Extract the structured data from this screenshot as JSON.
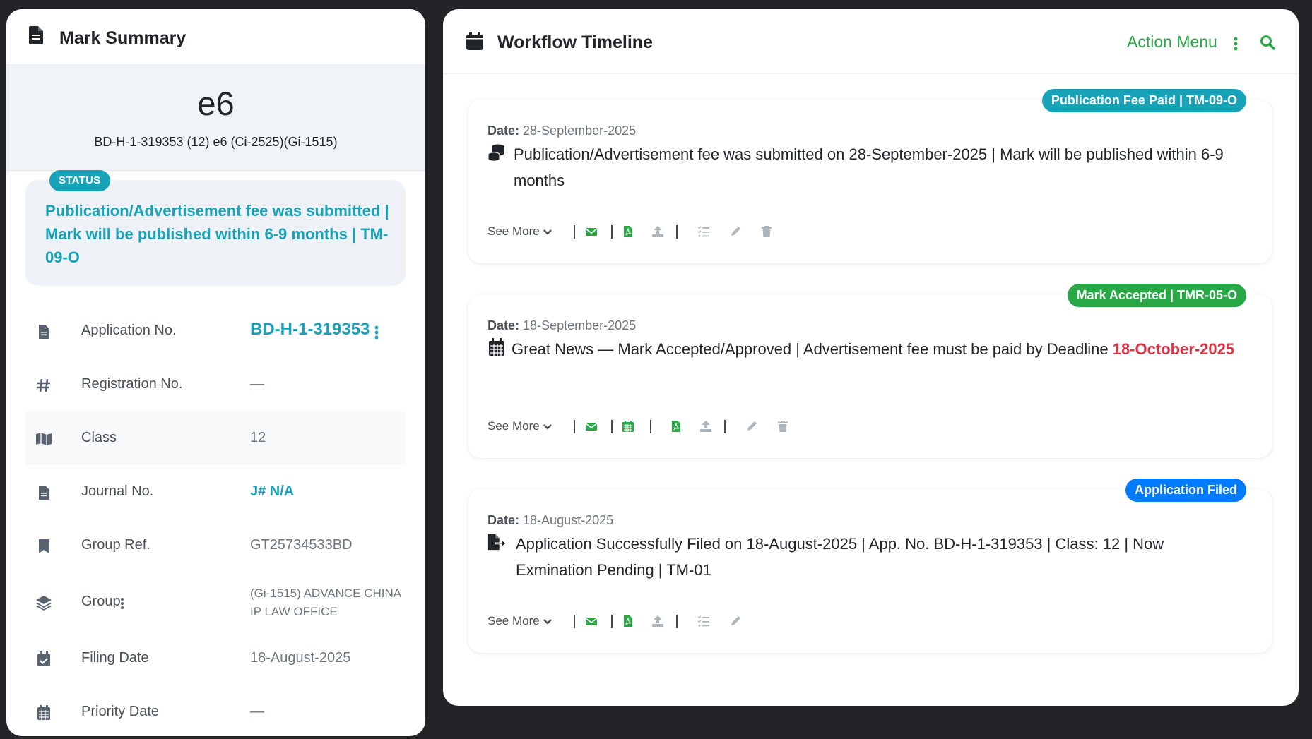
{
  "left": {
    "title": "Mark Summary",
    "mark_name": "e6",
    "mark_sub": "BD-H-1-319353 (12) e6 (Ci-2525)(Gi-1515)",
    "status_badge": "STATUS",
    "status_text": "Publication/Advertisement fee was submitted | Mark will be published within 6-9 months | TM-09-O",
    "rows": [
      {
        "label": "Application No.",
        "value": "BD-H-1-319353",
        "icon": "file-icon"
      },
      {
        "label": "Registration No.",
        "value": "—",
        "icon": "hashtag-icon"
      },
      {
        "label": "Class",
        "value": "12",
        "icon": "map-icon"
      },
      {
        "label": "Journal No.",
        "value": "J# N/A",
        "icon": "file-icon"
      },
      {
        "label": "Group Ref.",
        "value": "GT25734533BD",
        "icon": "bookmark-icon"
      },
      {
        "label": "Group",
        "value": "(Gi-1515) ADVANCE CHINA IP LAW OFFICE",
        "icon": "layers-icon"
      },
      {
        "label": "Filing Date",
        "value": "18-August-2025",
        "icon": "calendar-check-icon"
      },
      {
        "label": "Priority Date",
        "value": "—",
        "icon": "calendar-icon"
      }
    ]
  },
  "right": {
    "title": "Workflow Timeline",
    "action_menu": "Action Menu",
    "cards": [
      {
        "badge": "Publication Fee Paid | TM-09-O",
        "badge_color": "#17a2b8",
        "date_label": "Date:",
        "date": "28-September-2025",
        "message": "Publication/Advertisement fee was submitted on 28-September-2025 | Mark will be published within 6-9 months",
        "see_more": "See More"
      },
      {
        "badge": "Mark Accepted | TMR-05-O",
        "badge_color": "#28a745",
        "date_label": "Date:",
        "date": "18-September-2025",
        "message": "Great News — Mark Accepted/Approved | Advertisement fee must be paid by Deadline ",
        "deadline": "18-October-2025",
        "see_more": "See More"
      },
      {
        "badge": "Application Filed",
        "badge_color": "#007bff",
        "date_label": "Date:",
        "date": "18-August-2025",
        "message": "Application Successfully Filed on 18-August-2025 | App. No. BD-H-1-319353 | Class: 12 | Now Exmination Pending | TM-01",
        "see_more": "See More"
      }
    ]
  },
  "colors": {
    "info": "#17a2b8",
    "success": "#28a745",
    "primary": "#007bff",
    "danger": "#dc3545"
  }
}
